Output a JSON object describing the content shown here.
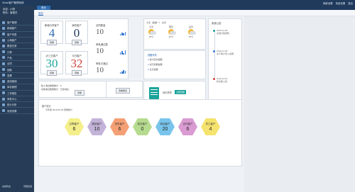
{
  "window": {
    "title": "Xinan客户管理系统",
    "right_links": [
      "换肤设置",
      "系统设置",
      "退出"
    ]
  },
  "sidebar": {
    "user_line1": "欢迎：小明",
    "user_line2": "职务：管理员",
    "items": [
      {
        "label": "客户管理"
      },
      {
        "label": "新增客户"
      },
      {
        "label": "客户列表"
      },
      {
        "label": "公海客户"
      },
      {
        "label": "跟进记录"
      },
      {
        "label": "订单"
      },
      {
        "label": "产品"
      },
      {
        "label": "合同"
      },
      {
        "label": "回款"
      },
      {
        "label": "发票"
      },
      {
        "label": "费用报销"
      },
      {
        "label": "库存管理"
      },
      {
        "label": "工作报告"
      },
      {
        "label": "审批中心"
      },
      {
        "label": "统计分析"
      },
      {
        "label": "系统设置"
      }
    ],
    "footer_left": "在线状态",
    "footer_right": "问题反馈"
  },
  "topnav": {
    "tab": "首页"
  },
  "subnav": {
    "crumb": "首页"
  },
  "stats": [
    {
      "label": "新增分享客户",
      "value": "4",
      "button": "查看"
    },
    {
      "label": "我的客户",
      "value": "0",
      "button": "查看"
    },
    {
      "label": "近三日客户",
      "value": "30",
      "button": "查看"
    },
    {
      "label": "今日客户",
      "value": "32",
      "button": "查看"
    }
  ],
  "mini_stats": [
    {
      "label": "合同数量",
      "value": "10"
    },
    {
      "label": "审批通过数",
      "value": "10"
    },
    {
      "label": "审批已通过",
      "value": "10"
    }
  ],
  "message_panel": {
    "line1": "私人消息数量统计：0",
    "line2": "系统消息数量统计：已读消息",
    "button_left": "查看",
    "button_right": "查看更多"
  },
  "weather": {
    "header": "今天（星期一） 北京",
    "days": [
      {
        "name": "今天",
        "temp": "18℃"
      },
      {
        "name": "明天",
        "temp": "20℃"
      },
      {
        "name": "后天",
        "temp": "19℃"
      }
    ]
  },
  "reminders": {
    "title": "提醒事项",
    "items": [
      "客户回访提醒",
      "合同到期提醒",
      "生日提醒"
    ]
  },
  "shortcut": {
    "label": "待办事项",
    "button": "立即查看"
  },
  "announcement": {
    "title": "系统公告",
    "items": [
      {
        "date": "2019-12-06",
        "text": "系统升级通知"
      },
      {
        "date": "2019-12-05",
        "text": "关于客户导入说明"
      },
      {
        "date": "2019-12-01",
        "text": "新功能上线"
      }
    ]
  },
  "summary": {
    "title": "客户统计",
    "subtitle": "今年度 2019-06-18 查看统计"
  },
  "categories": [
    {
      "label": "过季客户",
      "value": "6",
      "color": "#f4ef8a"
    },
    {
      "label": "跟进客户",
      "value": "10",
      "color": "#c3b3d9"
    },
    {
      "label": "流失客户",
      "value": "6",
      "color": "#f4a074"
    },
    {
      "label": "成交客户",
      "value": "0",
      "color": "#b6db8f"
    },
    {
      "label": "网站客户",
      "value": "20",
      "color": "#79c4ec"
    },
    {
      "label": "合作客户",
      "value": "6",
      "color": "#d99bd2"
    },
    {
      "label": "员工客户",
      "value": "4",
      "color": "#f5e36e"
    }
  ]
}
